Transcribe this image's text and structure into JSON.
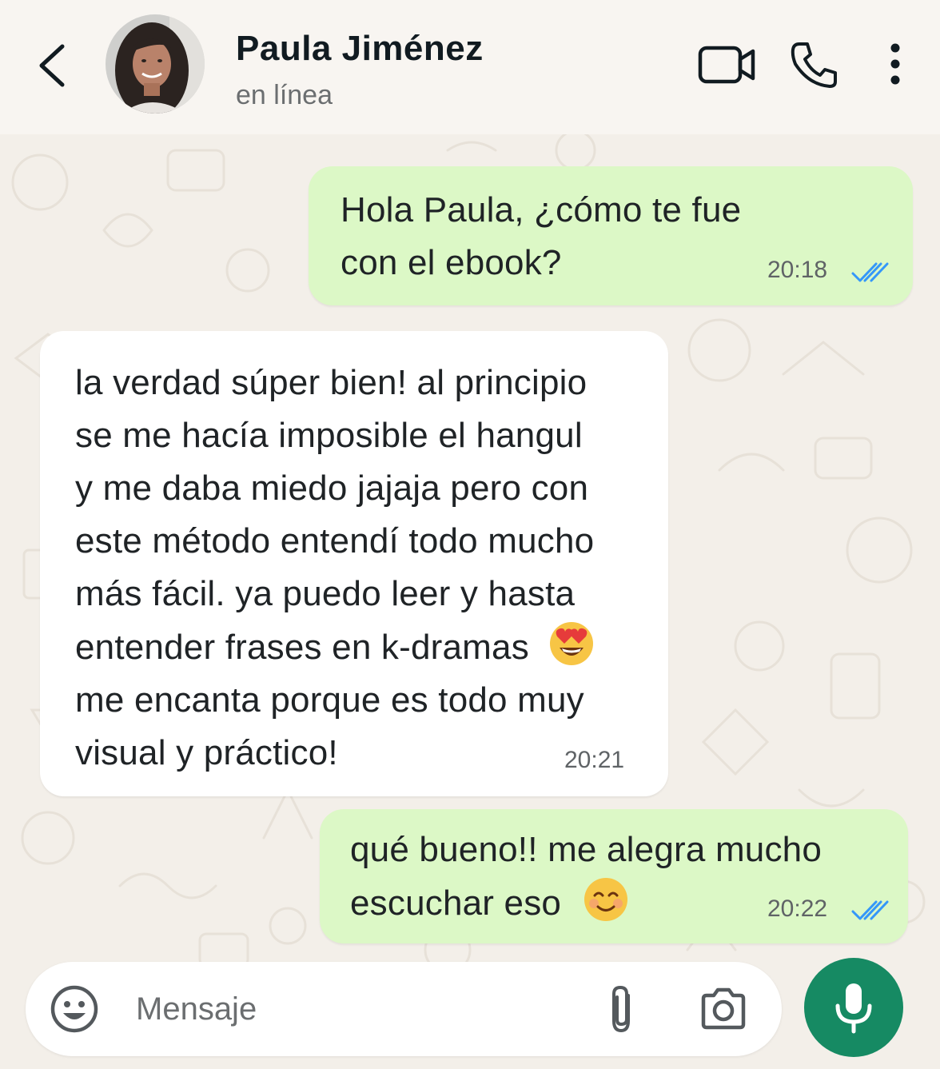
{
  "header": {
    "contact_name": "Paula Jiménez",
    "status": "en línea",
    "icons": [
      "back-icon",
      "video-call-icon",
      "voice-call-icon",
      "more-options-icon"
    ]
  },
  "messages": [
    {
      "direction": "outgoing",
      "lines": [
        "Hola Paula, ¿cómo te fue",
        "con el ebook?"
      ],
      "time": "20:18",
      "read": true
    },
    {
      "direction": "incoming",
      "lines": [
        "la verdad súper bien! al principio",
        "se me hacía imposible el hangul",
        "y me daba miedo jajaja pero con",
        "este método entendí todo mucho",
        "más fácil. ya puedo leer y hasta",
        "entender frases en k-dramas",
        "me encanta porque es todo muy",
        "visual y práctico!"
      ],
      "emoji": "heart-eyes-emoji",
      "time": "20:21"
    },
    {
      "direction": "outgoing",
      "lines": [
        "qué bueno!! me alegra mucho",
        "escuchar eso"
      ],
      "emoji": "smiling-emoji",
      "time": "20:22",
      "read": true
    }
  ],
  "input": {
    "placeholder": "Mensaje",
    "value": ""
  },
  "colors": {
    "outgoing_bubble": "#dcf8c6",
    "incoming_bubble": "#ffffff",
    "read_ticks": "#3497f9",
    "mic_button": "#168a63",
    "background": "#f3efe9"
  }
}
